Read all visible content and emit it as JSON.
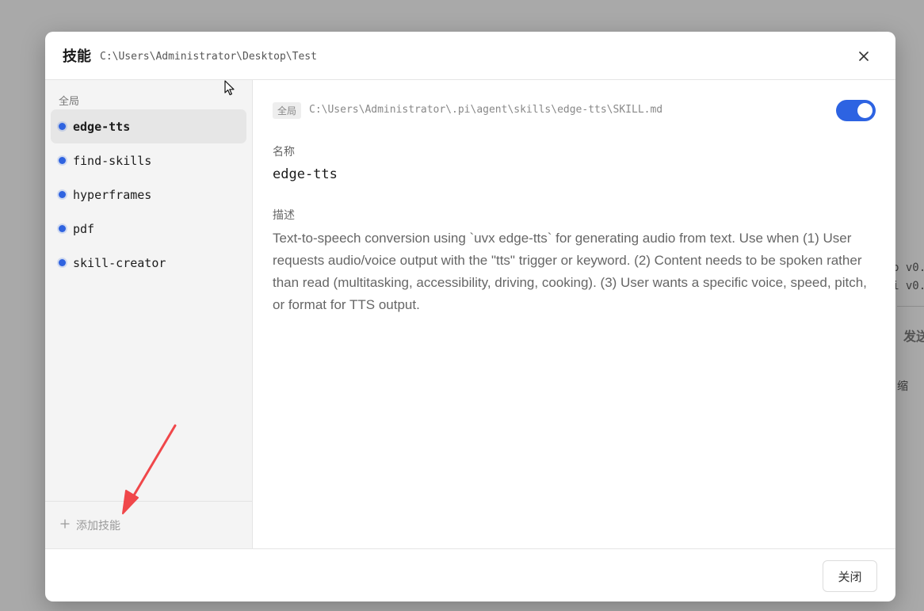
{
  "background": {
    "fragment_1": "p v0.",
    "fragment_2": "i v0.",
    "send_label": "发送",
    "shrink_label": "缩"
  },
  "dialog": {
    "title": "技能",
    "path": "C:\\Users\\Administrator\\Desktop\\Test",
    "close_icon": "close-icon"
  },
  "sidebar": {
    "group_label": "全局",
    "items": [
      {
        "label": "edge-tts",
        "active": true
      },
      {
        "label": "find-skills",
        "active": false
      },
      {
        "label": "hyperframes",
        "active": false
      },
      {
        "label": "pdf",
        "active": false
      },
      {
        "label": "skill-creator",
        "active": false
      }
    ],
    "add_label": "添加技能"
  },
  "detail": {
    "scope_badge": "全局",
    "file_path": "C:\\Users\\Administrator\\.pi\\agent\\skills\\edge-tts\\SKILL.md",
    "enabled": true,
    "name_label": "名称",
    "name_value": "edge-tts",
    "desc_label": "描述",
    "desc_value": "Text-to-speech conversion using `uvx edge-tts` for generating audio from text. Use when (1) User requests audio/voice output with the \"tts\" trigger or keyword. (2) Content needs to be spoken rather than read (multitasking, accessibility, driving, cooking). (3) User wants a specific voice, speed, pitch, or format for TTS output."
  },
  "footer": {
    "close_label": "关闭"
  },
  "colors": {
    "accent": "#2d63e2",
    "annotation_arrow": "#f0474a"
  }
}
